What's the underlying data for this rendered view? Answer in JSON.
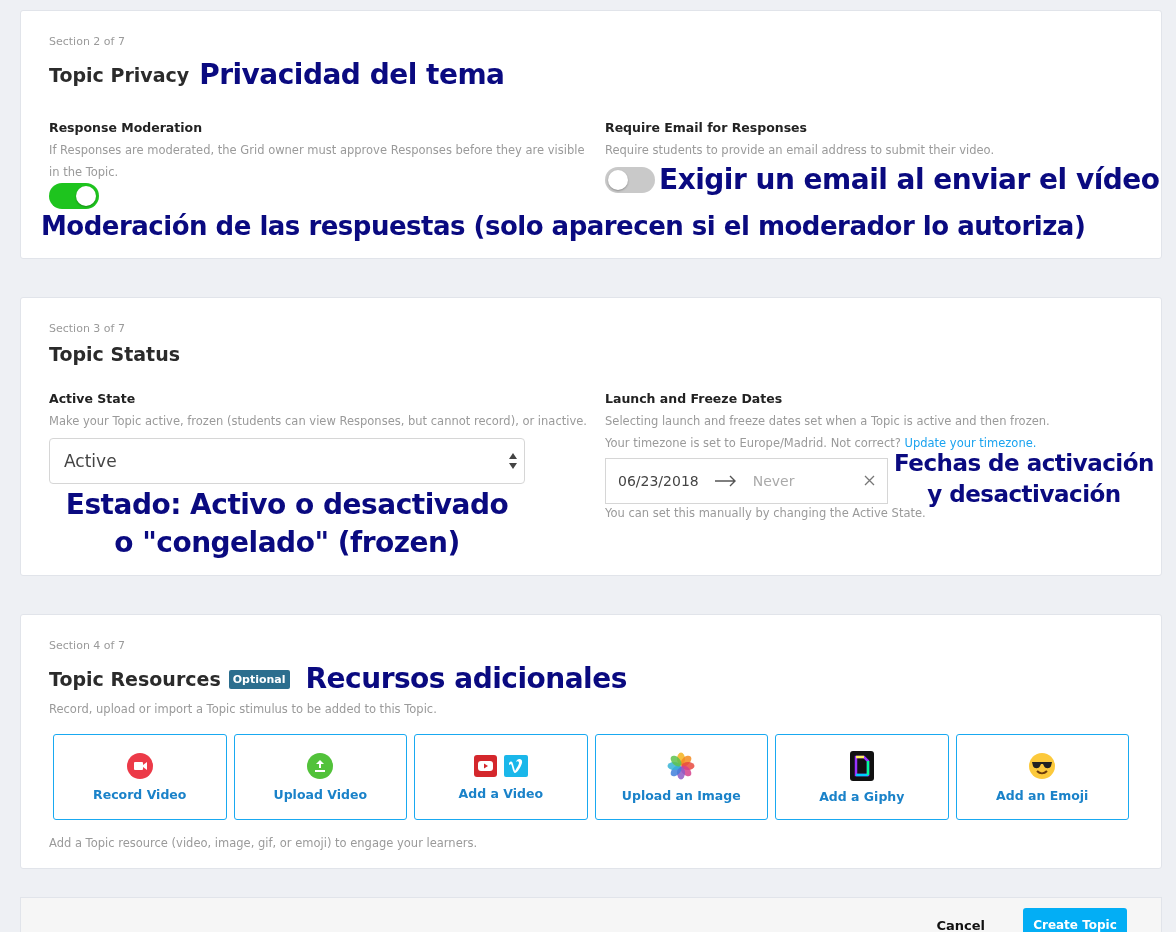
{
  "privacy": {
    "section": "Section 2 of 7",
    "title": "Topic Privacy",
    "annotation": "Privacidad del tema",
    "moderation": {
      "label": "Response Moderation",
      "description": "If Responses are moderated, the Grid owner must approve Responses before they are visible in the Topic.",
      "on": true
    },
    "email": {
      "label": "Require Email for Responses",
      "description": "Require students to provide an email address to submit their video.",
      "on": false,
      "annotation": "Exigir un email al enviar el vídeo"
    },
    "bottom_annotation": "Moderación de las respuestas (solo aparecen si el moderador lo autoriza)"
  },
  "status": {
    "section": "Section 3 of 7",
    "title": "Topic Status",
    "active_state": {
      "label": "Active State",
      "description": "Make your Topic active, frozen (students can view Responses, but cannot record), or inactive.",
      "value": "Active",
      "annotation_lines": [
        "Estado: Activo o desactivado",
        "o \"congelado\" (frozen)"
      ]
    },
    "dates": {
      "label": "Launch and Freeze Dates",
      "description": "Selecting launch and freeze dates set when a Topic is active and then frozen.",
      "timezone_note": "Your timezone is set to Europe/Madrid. Not correct?",
      "timezone_link": "Update your timezone.",
      "start": "06/23/2018",
      "end_placeholder": "Never",
      "hint": "You can set this manually by changing the Active State.",
      "annotation_lines": [
        "Fechas de activación",
        "y desactivación"
      ]
    }
  },
  "resources": {
    "section": "Section 4 of 7",
    "title": "Topic Resources",
    "badge": "Optional",
    "annotation": "Recursos adicionales",
    "description": "Record, upload or import a Topic stimulus to be added to this Topic.",
    "items": [
      {
        "kind": "record",
        "label": "Record Video"
      },
      {
        "kind": "upload",
        "label": "Upload Video"
      },
      {
        "kind": "video",
        "label": "Add a Video"
      },
      {
        "kind": "image",
        "label": "Upload an Image"
      },
      {
        "kind": "giphy",
        "label": "Add a Giphy"
      },
      {
        "kind": "emoji",
        "label": "Add an Emoji"
      }
    ],
    "footnote": "Add a Topic resource (video, image, gif, or emoji) to engage your learners."
  },
  "footer": {
    "cancel": "Cancel",
    "submit": "Create Topic"
  }
}
